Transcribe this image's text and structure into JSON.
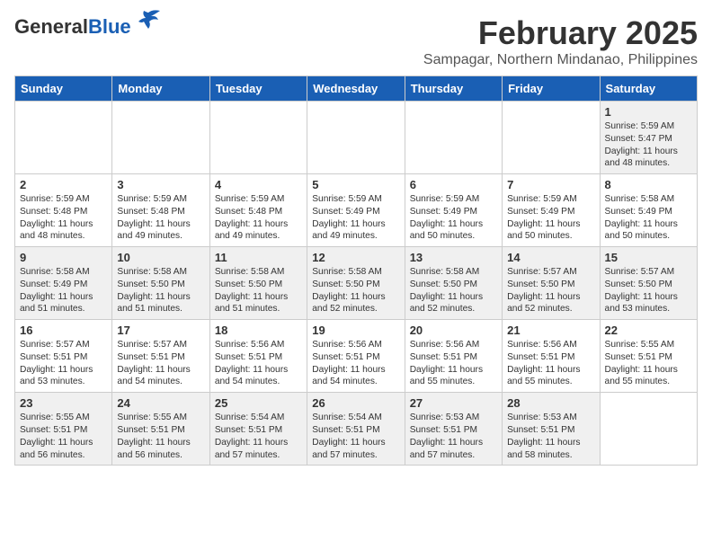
{
  "header": {
    "logo_general": "General",
    "logo_blue": "Blue",
    "month_year": "February 2025",
    "location": "Sampagar, Northern Mindanao, Philippines"
  },
  "days_of_week": [
    "Sunday",
    "Monday",
    "Tuesday",
    "Wednesday",
    "Thursday",
    "Friday",
    "Saturday"
  ],
  "weeks": [
    [
      {
        "day": "",
        "info": ""
      },
      {
        "day": "",
        "info": ""
      },
      {
        "day": "",
        "info": ""
      },
      {
        "day": "",
        "info": ""
      },
      {
        "day": "",
        "info": ""
      },
      {
        "day": "",
        "info": ""
      },
      {
        "day": "1",
        "info": "Sunrise: 5:59 AM\nSunset: 5:47 PM\nDaylight: 11 hours\nand 48 minutes."
      }
    ],
    [
      {
        "day": "2",
        "info": "Sunrise: 5:59 AM\nSunset: 5:48 PM\nDaylight: 11 hours\nand 48 minutes."
      },
      {
        "day": "3",
        "info": "Sunrise: 5:59 AM\nSunset: 5:48 PM\nDaylight: 11 hours\nand 49 minutes."
      },
      {
        "day": "4",
        "info": "Sunrise: 5:59 AM\nSunset: 5:48 PM\nDaylight: 11 hours\nand 49 minutes."
      },
      {
        "day": "5",
        "info": "Sunrise: 5:59 AM\nSunset: 5:49 PM\nDaylight: 11 hours\nand 49 minutes."
      },
      {
        "day": "6",
        "info": "Sunrise: 5:59 AM\nSunset: 5:49 PM\nDaylight: 11 hours\nand 50 minutes."
      },
      {
        "day": "7",
        "info": "Sunrise: 5:59 AM\nSunset: 5:49 PM\nDaylight: 11 hours\nand 50 minutes."
      },
      {
        "day": "8",
        "info": "Sunrise: 5:58 AM\nSunset: 5:49 PM\nDaylight: 11 hours\nand 50 minutes."
      }
    ],
    [
      {
        "day": "9",
        "info": "Sunrise: 5:58 AM\nSunset: 5:49 PM\nDaylight: 11 hours\nand 51 minutes."
      },
      {
        "day": "10",
        "info": "Sunrise: 5:58 AM\nSunset: 5:50 PM\nDaylight: 11 hours\nand 51 minutes."
      },
      {
        "day": "11",
        "info": "Sunrise: 5:58 AM\nSunset: 5:50 PM\nDaylight: 11 hours\nand 51 minutes."
      },
      {
        "day": "12",
        "info": "Sunrise: 5:58 AM\nSunset: 5:50 PM\nDaylight: 11 hours\nand 52 minutes."
      },
      {
        "day": "13",
        "info": "Sunrise: 5:58 AM\nSunset: 5:50 PM\nDaylight: 11 hours\nand 52 minutes."
      },
      {
        "day": "14",
        "info": "Sunrise: 5:57 AM\nSunset: 5:50 PM\nDaylight: 11 hours\nand 52 minutes."
      },
      {
        "day": "15",
        "info": "Sunrise: 5:57 AM\nSunset: 5:50 PM\nDaylight: 11 hours\nand 53 minutes."
      }
    ],
    [
      {
        "day": "16",
        "info": "Sunrise: 5:57 AM\nSunset: 5:51 PM\nDaylight: 11 hours\nand 53 minutes."
      },
      {
        "day": "17",
        "info": "Sunrise: 5:57 AM\nSunset: 5:51 PM\nDaylight: 11 hours\nand 54 minutes."
      },
      {
        "day": "18",
        "info": "Sunrise: 5:56 AM\nSunset: 5:51 PM\nDaylight: 11 hours\nand 54 minutes."
      },
      {
        "day": "19",
        "info": "Sunrise: 5:56 AM\nSunset: 5:51 PM\nDaylight: 11 hours\nand 54 minutes."
      },
      {
        "day": "20",
        "info": "Sunrise: 5:56 AM\nSunset: 5:51 PM\nDaylight: 11 hours\nand 55 minutes."
      },
      {
        "day": "21",
        "info": "Sunrise: 5:56 AM\nSunset: 5:51 PM\nDaylight: 11 hours\nand 55 minutes."
      },
      {
        "day": "22",
        "info": "Sunrise: 5:55 AM\nSunset: 5:51 PM\nDaylight: 11 hours\nand 55 minutes."
      }
    ],
    [
      {
        "day": "23",
        "info": "Sunrise: 5:55 AM\nSunset: 5:51 PM\nDaylight: 11 hours\nand 56 minutes."
      },
      {
        "day": "24",
        "info": "Sunrise: 5:55 AM\nSunset: 5:51 PM\nDaylight: 11 hours\nand 56 minutes."
      },
      {
        "day": "25",
        "info": "Sunrise: 5:54 AM\nSunset: 5:51 PM\nDaylight: 11 hours\nand 57 minutes."
      },
      {
        "day": "26",
        "info": "Sunrise: 5:54 AM\nSunset: 5:51 PM\nDaylight: 11 hours\nand 57 minutes."
      },
      {
        "day": "27",
        "info": "Sunrise: 5:53 AM\nSunset: 5:51 PM\nDaylight: 11 hours\nand 57 minutes."
      },
      {
        "day": "28",
        "info": "Sunrise: 5:53 AM\nSunset: 5:51 PM\nDaylight: 11 hours\nand 58 minutes."
      },
      {
        "day": "",
        "info": ""
      }
    ]
  ]
}
